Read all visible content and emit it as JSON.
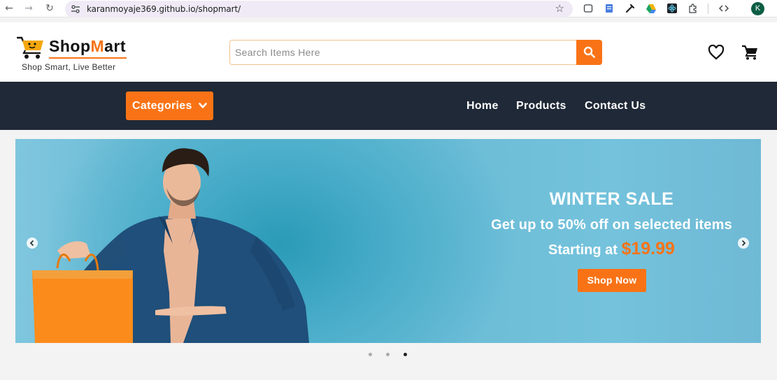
{
  "browser": {
    "url": "karanmoyaje369.github.io/shopmart/",
    "profile_initial": "K",
    "icons": [
      "back-icon",
      "forward-icon",
      "reload-icon",
      "site-settings-icon",
      "bookmark-star-icon",
      "extension-icons",
      "devtools-icon"
    ]
  },
  "header": {
    "logo_prefix": "Shop",
    "logo_m": "M",
    "logo_suffix": "art",
    "tagline": "Shop Smart, Live Better",
    "search_placeholder": "Search Items Here",
    "accent_color": "#f97316"
  },
  "navbar": {
    "categories_label": "Categories",
    "links": [
      "Home",
      "Products",
      "Contact Us"
    ],
    "bg_color": "#1f2937"
  },
  "hero": {
    "title": "WINTER SALE",
    "subtitle": "Get up to 50% off on selected items",
    "starting_prefix": "Starting at",
    "price": "$19.99",
    "cta": "Shop Now",
    "slide_count": 3,
    "active_slide": 3
  }
}
